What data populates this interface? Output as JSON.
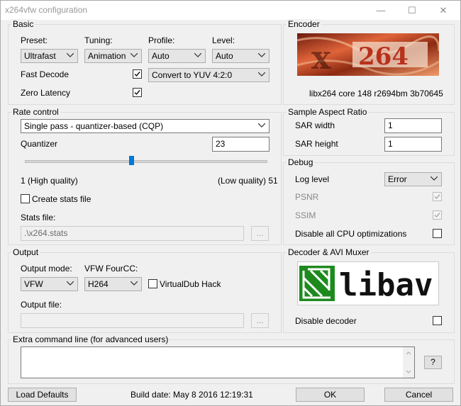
{
  "window": {
    "title": "x264vfw configuration",
    "minimize_glyph": "—",
    "maximize_glyph": "☐",
    "close_glyph": "✕"
  },
  "basic": {
    "title": "Basic",
    "preset_label": "Preset:",
    "preset_value": "Ultrafast",
    "tuning_label": "Tuning:",
    "tuning_value": "Animation",
    "profile_label": "Profile:",
    "profile_value": "Auto",
    "level_label": "Level:",
    "level_value": "Auto",
    "fast_decode_label": "Fast Decode",
    "fast_decode_checked": true,
    "zero_latency_label": "Zero Latency",
    "zero_latency_checked": true,
    "colorspace_value": "Convert to YUV 4:2:0"
  },
  "encoder": {
    "title": "Encoder",
    "logo_text": "x264",
    "version": "libx264 core 148 r2694bm 3b70645"
  },
  "rate_control": {
    "title": "Rate control",
    "mode_value": "Single pass - quantizer-based (CQP)",
    "quantizer_label": "Quantizer",
    "quantizer_value": "23",
    "slider_min": 1,
    "slider_max": 51,
    "low_label": "1 (High quality)",
    "high_label": "(Low quality) 51",
    "create_stats_label": "Create stats file",
    "create_stats_checked": false,
    "stats_file_label": "Stats file:",
    "stats_file_value": ".\\x264.stats",
    "browse_label": "..."
  },
  "sar": {
    "title": "Sample Aspect Ratio",
    "width_label": "SAR width",
    "width_value": "1",
    "height_label": "SAR height",
    "height_value": "1"
  },
  "debug": {
    "title": "Debug",
    "log_level_label": "Log level",
    "log_level_value": "Error",
    "psnr_label": "PSNR",
    "psnr_checked": true,
    "ssim_label": "SSIM",
    "ssim_checked": true,
    "disable_cpu_label": "Disable all CPU optimizations",
    "disable_cpu_checked": false
  },
  "output": {
    "title": "Output",
    "mode_label": "Output mode:",
    "mode_value": "VFW",
    "fourcc_label": "VFW FourCC:",
    "fourcc_value": "H264",
    "vdub_label": "VirtualDub Hack",
    "vdub_checked": false,
    "file_label": "Output file:",
    "file_value": "",
    "browse_label": "..."
  },
  "decoder": {
    "title": "Decoder & AVI Muxer",
    "logo_text": "libav",
    "disable_label": "Disable decoder",
    "disable_checked": false
  },
  "extra": {
    "title": "Extra command line (for advanced users)",
    "value": "",
    "help_label": "?"
  },
  "footer": {
    "load_defaults": "Load Defaults",
    "build_date": "Build date: May  8 2016 12:19:31",
    "ok": "OK",
    "cancel": "Cancel"
  },
  "colors": {
    "accent_blue": "#0078d7",
    "libav_green": "#1e8a1e",
    "logo_red": "#c0321e"
  }
}
